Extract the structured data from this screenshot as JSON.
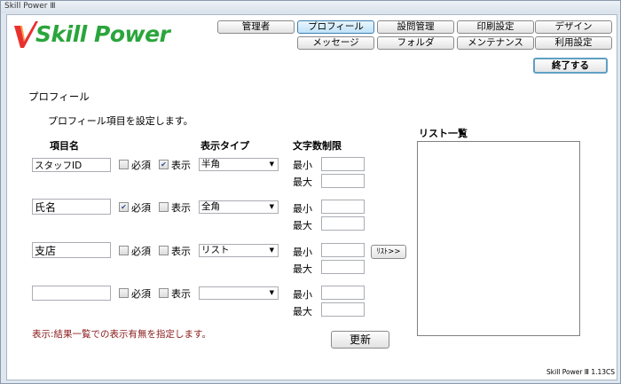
{
  "window": {
    "title": "Skill Power Ⅲ"
  },
  "logo": {
    "text": "Skill Power"
  },
  "nav": [
    {
      "label": "管理者"
    },
    {
      "label": "プロフィール"
    },
    {
      "label": "設問管理"
    },
    {
      "label": "印刷設定"
    },
    {
      "label": "デザイン"
    },
    {
      "label": "メッセージ"
    },
    {
      "label": "フォルダ"
    },
    {
      "label": "メンテナンス"
    },
    {
      "label": "利用設定"
    }
  ],
  "end_button": "終了する",
  "section_title": "プロフィール",
  "section_desc": "プロフィール項目を設定します。",
  "headers": {
    "item_name": "項目名",
    "display_type": "表示タイプ",
    "char_limit": "文字数制限"
  },
  "labels": {
    "required": "必須",
    "display": "表示",
    "min": "最小",
    "max": "最大"
  },
  "rows": [
    {
      "name": "スタッフID",
      "required": false,
      "display": true,
      "type": "半角",
      "min": "",
      "max": ""
    },
    {
      "name": "氏名",
      "required": true,
      "display": false,
      "type": "全角",
      "min": "",
      "max": ""
    },
    {
      "name": "支店",
      "required": false,
      "display": false,
      "type": "リスト",
      "min": "",
      "max": ""
    },
    {
      "name": "",
      "required": false,
      "display": false,
      "type": "",
      "min": "",
      "max": ""
    }
  ],
  "list_button": "ﾘｽﾄ>>",
  "list_title": "リスト一覧",
  "update_button": "更新",
  "note": "表示:結果一覧での表示有無を指定します。",
  "footer": "Skill Power Ⅲ  1.13CS"
}
